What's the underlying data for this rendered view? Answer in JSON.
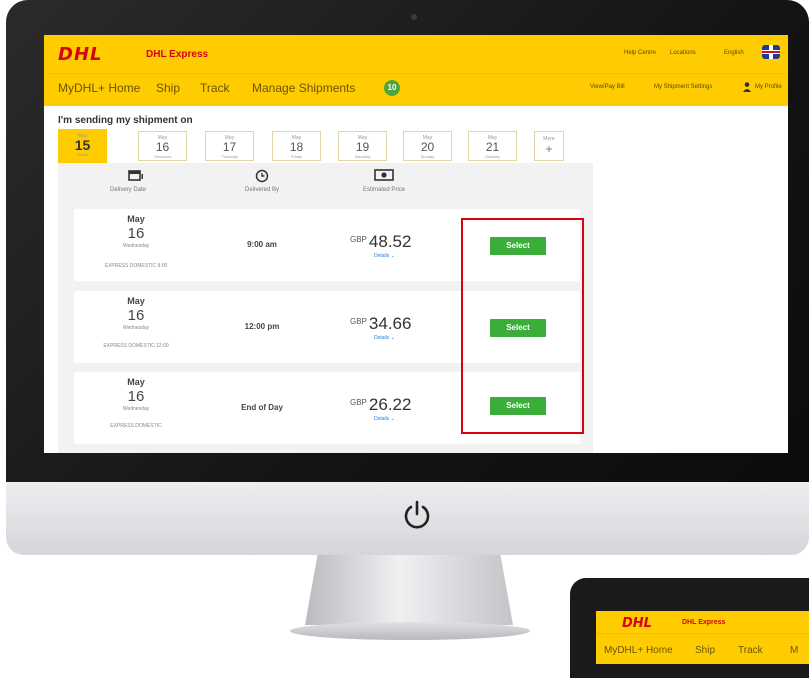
{
  "header": {
    "logo": "DHL",
    "brand": "DHL Express",
    "links": [
      "Help Centre",
      "Locations",
      "English"
    ]
  },
  "nav": {
    "items": [
      "MyDHL+ Home",
      "Ship",
      "Track",
      "Manage Shipments"
    ],
    "badge": "10",
    "right_links": [
      "View/Pay Bill",
      "My Shipment Settings",
      "My Profile"
    ]
  },
  "heading": "I'm sending my shipment on",
  "dates": [
    {
      "month": "May",
      "day": "15",
      "weekday": "Today",
      "active": true
    },
    {
      "month": "May",
      "day": "16",
      "weekday": "Tomorrow"
    },
    {
      "month": "May",
      "day": "17",
      "weekday": "Thursday"
    },
    {
      "month": "May",
      "day": "18",
      "weekday": "Friday"
    },
    {
      "month": "May",
      "day": "19",
      "weekday": "Saturday"
    },
    {
      "month": "May",
      "day": "20",
      "weekday": "Sunday"
    },
    {
      "month": "May",
      "day": "21",
      "weekday": "Monday"
    }
  ],
  "more_dates": {
    "label": "More",
    "symbol": "+"
  },
  "columns": [
    "Delivery Date",
    "Delivered By",
    "Estimated Price"
  ],
  "column_icons": [
    "calendar-icon",
    "clock-icon",
    "money-icon"
  ],
  "options": [
    {
      "month": "May",
      "day": "16",
      "weekday": "Wednesday",
      "service": "EXPRESS DOMESTIC 9:00",
      "time": "9:00 am",
      "currency": "GBP",
      "price": "48.52",
      "details": "Details",
      "select": "Select"
    },
    {
      "month": "May",
      "day": "16",
      "weekday": "Wednesday",
      "service": "EXPRESS DOMESTIC 12:00",
      "time": "12:00 pm",
      "currency": "GBP",
      "price": "34.66",
      "details": "Details",
      "select": "Select"
    },
    {
      "month": "May",
      "day": "16",
      "weekday": "Wednesday",
      "service": "EXPRESS DOMESTIC",
      "time": "End of Day",
      "currency": "GBP",
      "price": "26.22",
      "details": "Details",
      "select": "Select"
    }
  ],
  "second_screen": {
    "logo": "DHL",
    "brand": "DHL Express",
    "nav": [
      "MyDHL+ Home",
      "Ship",
      "Track",
      "M"
    ]
  },
  "colors": {
    "dhl_yellow": "#fecc00",
    "dhl_red": "#d40511",
    "select_green": "#3bae3a",
    "highlight_red": "#d40511"
  }
}
